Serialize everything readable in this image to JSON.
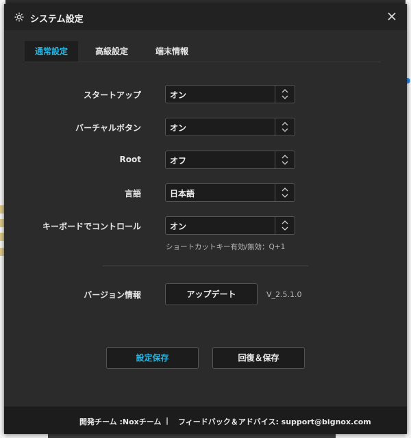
{
  "dialog": {
    "title": "システム設定",
    "tabs": [
      {
        "label": "通常設定",
        "active": true
      },
      {
        "label": "高級設定",
        "active": false
      },
      {
        "label": "端末情報",
        "active": false
      }
    ],
    "settings": [
      {
        "label": "スタートアップ",
        "value": "オン"
      },
      {
        "label": "バーチャルボタン",
        "value": "オン"
      },
      {
        "label": "Root",
        "value": "オフ"
      },
      {
        "label": "言語",
        "value": "日本語"
      },
      {
        "label": "キーボードでコントロール",
        "value": "オン"
      }
    ],
    "shortcut_hint": "ショートカットキー有効/無効：Q+1",
    "version": {
      "label": "バージョン情報",
      "update_button": "アップデート",
      "number": "V_2.5.1.0"
    },
    "buttons": {
      "save": "設定保存",
      "restore_save": "回復＆保存"
    },
    "footer": {
      "developer": "開発チーム  :Noxチーム",
      "separator": "|",
      "feedback": "フィードバック＆アドバイス:  support@bignox.com"
    }
  },
  "colors": {
    "accent": "#27b6e3",
    "dialog_bg": "#2b2b2b",
    "control_bg": "#1c1c1c"
  }
}
